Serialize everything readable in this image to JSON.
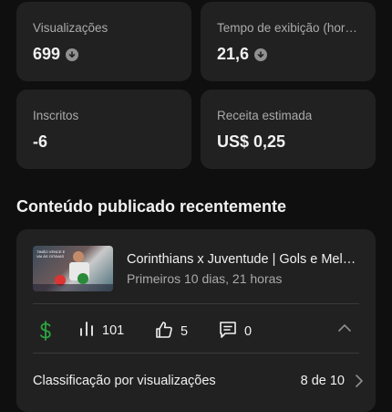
{
  "metrics": {
    "views": {
      "label": "Visualizações",
      "value": "699",
      "trend_icon": "arrow-down-circle-icon"
    },
    "watch_time": {
      "label": "Tempo de exibição (horas)",
      "value": "21,6",
      "trend_icon": "arrow-down-circle-icon"
    },
    "subscribers": {
      "label": "Inscritos",
      "value": "-6"
    },
    "revenue": {
      "label": "Receita estimada",
      "value": "US$ 0,25"
    }
  },
  "recent": {
    "title": "Conteúdo publicado recentemente",
    "video": {
      "title": "Corinthians x Juventude | Gols e Melhores Momentos",
      "subtitle": "Primeiros 10 dias, 21 horas",
      "thumbnail_text": "TIMÃO VENCE E VAI ÀS OITAVAS"
    },
    "stats": {
      "monetization_icon": "dollar-icon",
      "views": "101",
      "likes": "5",
      "comments": "0"
    },
    "ranking": {
      "label": "Classificação por visualizações",
      "value": "8 de 10"
    }
  },
  "colors": {
    "background": "#0f0f0f",
    "card": "#212121",
    "monetized": "#2ba640"
  }
}
